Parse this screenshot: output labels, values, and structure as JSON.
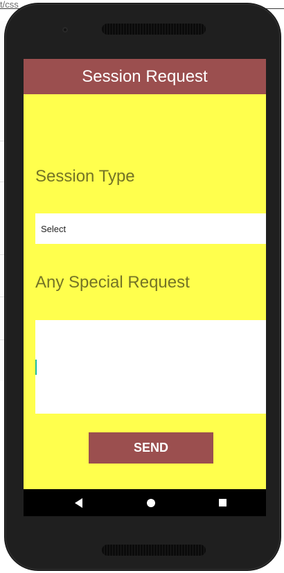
{
  "background": {
    "url_fragment": "t/css",
    "side_chars": [
      "a",
      "c"
    ]
  },
  "app": {
    "title": "Session Request"
  },
  "form": {
    "session_type_label": "Session Type",
    "session_type_value": "Select",
    "special_request_label": "Any Special Request",
    "special_request_value": "",
    "send_label": "SEND"
  },
  "nav": {
    "back_icon": "back-triangle-icon",
    "home_icon": "home-circle-icon",
    "recents_icon": "recents-square-icon"
  },
  "colors": {
    "app_bar": "#9b4f4f",
    "screen_bg": "#ffff4d",
    "label_text": "#747426",
    "button_bg": "#9b4f4f"
  }
}
